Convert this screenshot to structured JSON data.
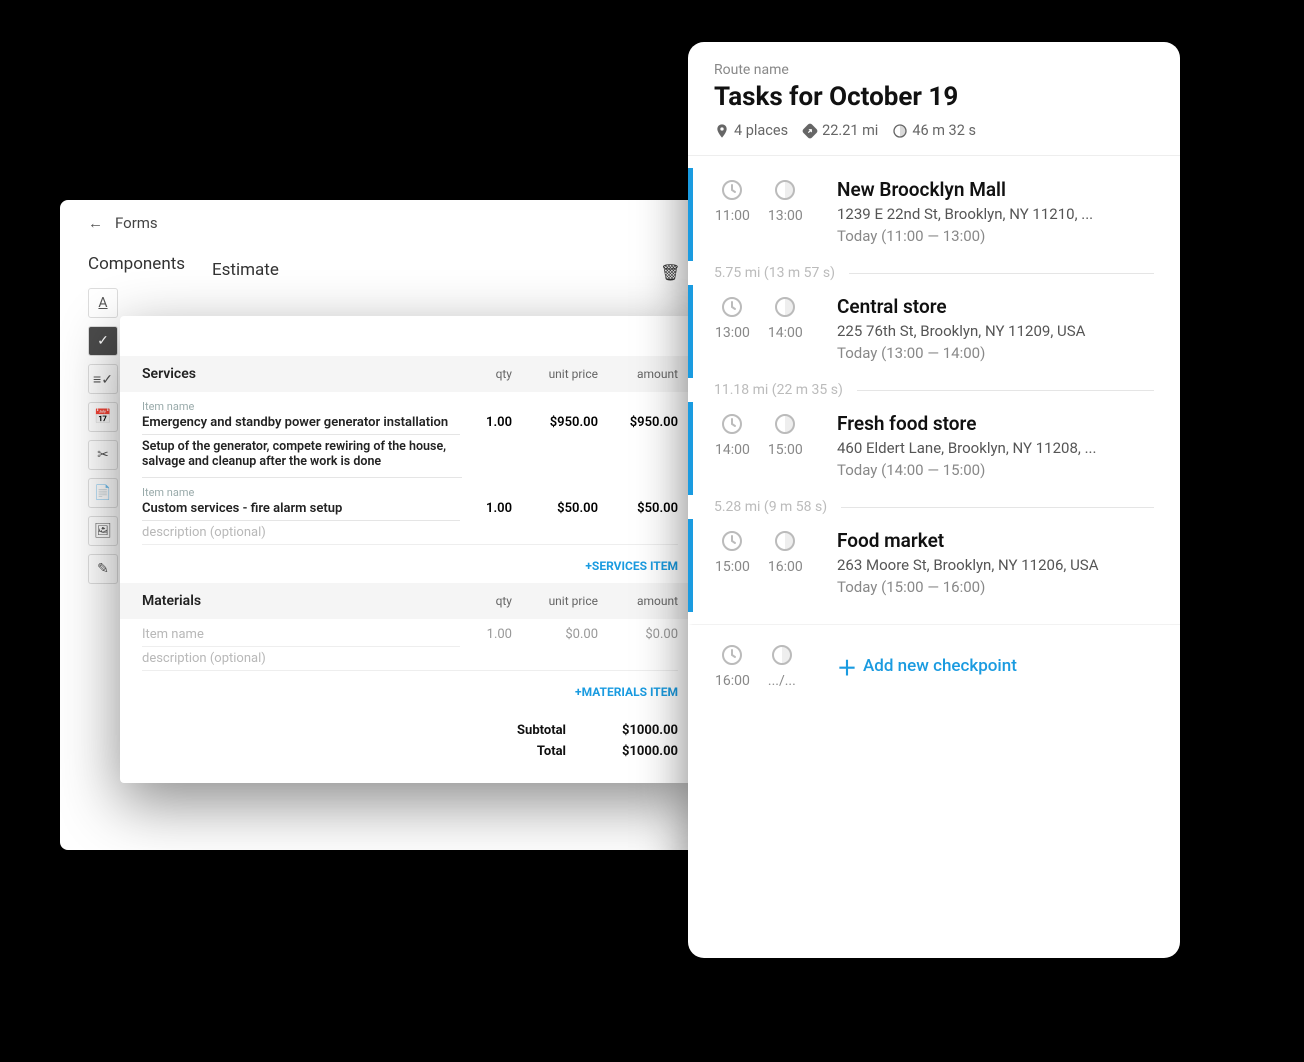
{
  "forms": {
    "back_label": "Forms",
    "components_title": "Components",
    "estimate_title": "Estimate"
  },
  "estimate": {
    "services": {
      "header": "Services",
      "cols": {
        "qty": "qty",
        "unit_price": "unit price",
        "amount": "amount"
      },
      "items": [
        {
          "name_label": "Item name",
          "name": "Emergency and standby power generator installation",
          "qty": "1.00",
          "unit_price": "$950.00",
          "amount": "$950.00",
          "description": "Setup of the generator, compete rewiring of the house, salvage and cleanup after the work is done"
        },
        {
          "name_label": "Item name",
          "name": "Custom services - fire alarm setup",
          "qty": "1.00",
          "unit_price": "$50.00",
          "amount": "$50.00",
          "description_placeholder": "description (optional)"
        }
      ],
      "add_link": "+SERVICES ITEM"
    },
    "materials": {
      "header": "Materials",
      "cols": {
        "qty": "qty",
        "unit_price": "unit price",
        "amount": "amount"
      },
      "item": {
        "name_placeholder": "Item name",
        "qty": "1.00",
        "unit_price": "$0.00",
        "amount": "$0.00",
        "description_placeholder": "description (optional)"
      },
      "add_link": "+MATERIALS ITEM"
    },
    "totals": {
      "subtotal_label": "Subtotal",
      "subtotal": "$1000.00",
      "total_label": "Total",
      "total": "$1000.00"
    }
  },
  "route": {
    "small_label": "Route name",
    "title": "Tasks for October 19",
    "stats": {
      "places": "4 places",
      "distance": "22.21 mi",
      "duration": "46 m 32 s"
    },
    "stops": [
      {
        "start": "11:00",
        "end": "13:00",
        "name": "New Broocklyn Mall",
        "address": "1239 E 22nd St, Brooklyn, NY 11210, ...",
        "window": "Today (11:00 — 13:00)",
        "gap_after": "5.75 mi (13 m 57 s)"
      },
      {
        "start": "13:00",
        "end": "14:00",
        "name": "Central store",
        "address": "225 76th St, Brooklyn, NY 11209, USA",
        "window": "Today (13:00 — 14:00)",
        "gap_after": "11.18 mi (22 m 35 s)"
      },
      {
        "start": "14:00",
        "end": "15:00",
        "name": "Fresh food store",
        "address": "460 Eldert Lane, Brooklyn, NY 11208, ...",
        "window": "Today (14:00 — 15:00)",
        "gap_after": "5.28 mi (9 m 58 s)"
      },
      {
        "start": "15:00",
        "end": "16:00",
        "name": "Food market",
        "address": "263 Moore St, Brooklyn, NY 11206, USA",
        "window": "Today (15:00 — 16:00)"
      }
    ],
    "new_stop": {
      "start": "16:00",
      "end": ".../...",
      "add_label": "Add new checkpoint"
    }
  },
  "icons": {
    "components": [
      "text-icon",
      "checkbox-icon",
      "list-icon",
      "date-icon",
      "cut-icon",
      "file-icon",
      "image-icon",
      "pencil-icon"
    ]
  }
}
